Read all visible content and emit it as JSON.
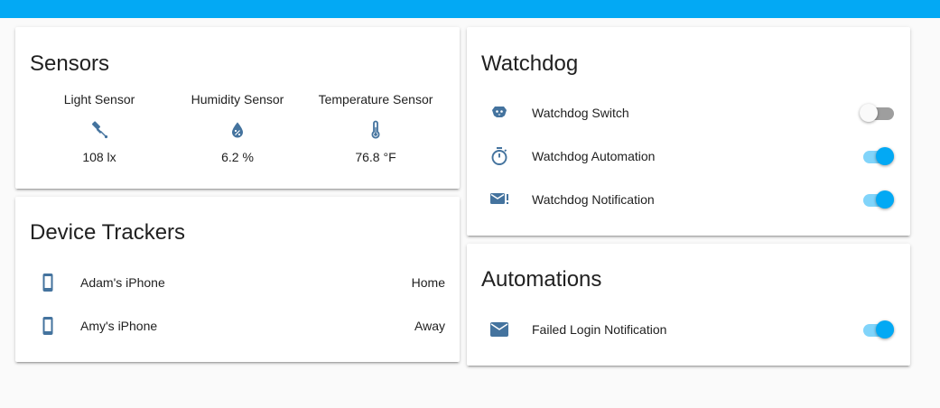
{
  "colors": {
    "accent": "#03a9f4",
    "icon": "#44739e",
    "background": "#fafafa"
  },
  "sensors_card": {
    "title": "Sensors",
    "items": [
      {
        "name": "Light Sensor",
        "value": "108 lx",
        "icon": "light-sensor-icon"
      },
      {
        "name": "Humidity Sensor",
        "value": "6.2 %",
        "icon": "water-percent-icon"
      },
      {
        "name": "Temperature Sensor",
        "value": "76.8 °F",
        "icon": "thermometer-icon"
      }
    ]
  },
  "device_trackers_card": {
    "title": "Device Trackers",
    "items": [
      {
        "name": "Adam's iPhone",
        "state": "Home",
        "icon": "cellphone-icon"
      },
      {
        "name": "Amy's iPhone",
        "state": "Away",
        "icon": "cellphone-icon"
      }
    ]
  },
  "watchdog_card": {
    "title": "Watchdog",
    "items": [
      {
        "name": "Watchdog Switch",
        "on": false,
        "icon": "dog-icon"
      },
      {
        "name": "Watchdog Automation",
        "on": true,
        "icon": "timer-icon"
      },
      {
        "name": "Watchdog Notification",
        "on": true,
        "icon": "email-alert-icon"
      }
    ]
  },
  "automations_card": {
    "title": "Automations",
    "items": [
      {
        "name": "Failed Login Notification",
        "on": true,
        "icon": "email-icon"
      }
    ]
  }
}
